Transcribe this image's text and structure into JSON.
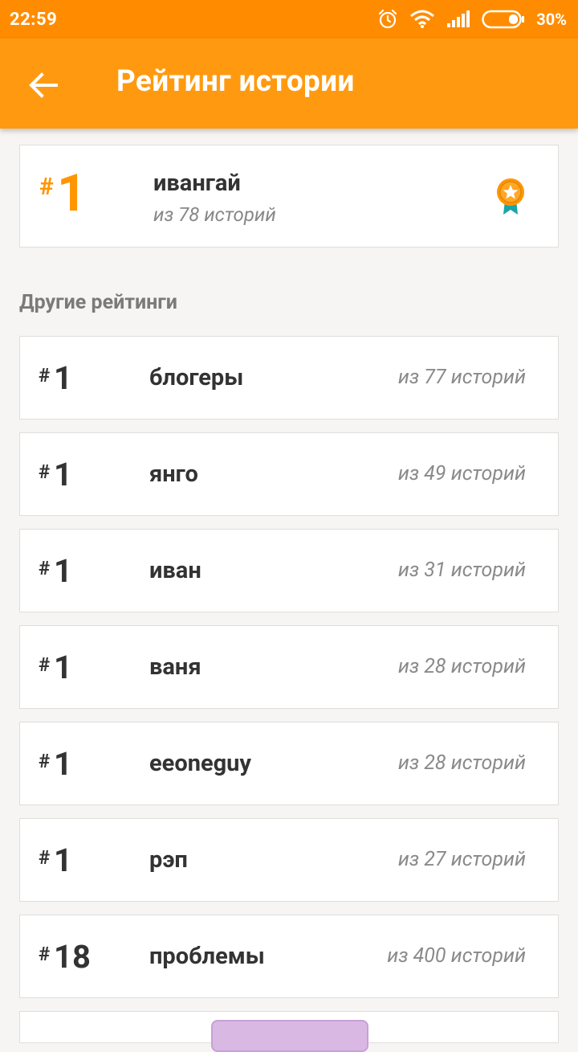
{
  "status_bar": {
    "time": "22:59",
    "battery_percent": "30%"
  },
  "app_bar": {
    "title": "Рейтинг истории"
  },
  "main_rating": {
    "hash": "#",
    "rank": "1",
    "name": "ивангай",
    "subtitle": "из 78 историй"
  },
  "section": {
    "title": "Другие рейтинги"
  },
  "ratings": [
    {
      "hash": "#",
      "rank": "1",
      "name": "блогеры",
      "count": "из 77 историй"
    },
    {
      "hash": "#",
      "rank": "1",
      "name": "янго",
      "count": "из 49 историй"
    },
    {
      "hash": "#",
      "rank": "1",
      "name": "иван",
      "count": "из 31 историй"
    },
    {
      "hash": "#",
      "rank": "1",
      "name": "ваня",
      "count": "из 28 историй"
    },
    {
      "hash": "#",
      "rank": "1",
      "name": "eeoneguy",
      "count": "из 28 историй"
    },
    {
      "hash": "#",
      "rank": "1",
      "name": "рэп",
      "count": "из 27 историй"
    },
    {
      "hash": "#",
      "rank": "18",
      "name": "проблемы",
      "count": "из 400 историй"
    }
  ],
  "colors": {
    "status_bar": "#ff8c00",
    "app_bar": "#ff9a10",
    "accent": "#ff9500",
    "badge_ribbon": "#1aa3a8"
  },
  "icons": {
    "back": "arrow-left-icon",
    "badge": "award-badge-icon"
  }
}
